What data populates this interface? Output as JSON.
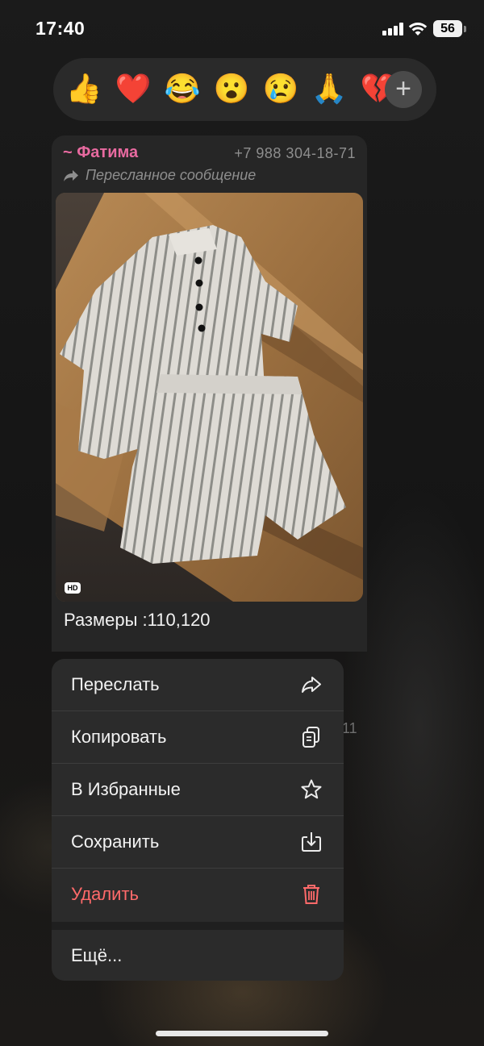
{
  "status_bar": {
    "time": "17:40",
    "battery": "56"
  },
  "reactions": {
    "items": [
      "👍",
      "❤️",
      "😂",
      "😮",
      "😢",
      "🙏",
      "💔"
    ],
    "add_label": "+"
  },
  "message": {
    "sender_name": "~ Фатима",
    "sender_phone": "+7 988 304-18-71",
    "forwarded_label": "Пересланное сообщение",
    "hd_badge": "HD",
    "caption": "Размеры :110,120",
    "hidden_timestamp": "11"
  },
  "context_menu": {
    "items": [
      {
        "label": "Переслать",
        "icon": "forward-icon"
      },
      {
        "label": "Копировать",
        "icon": "copy-icon"
      },
      {
        "label": "В Избранные",
        "icon": "star-icon"
      },
      {
        "label": "Сохранить",
        "icon": "save-icon"
      },
      {
        "label": "Удалить",
        "icon": "trash-icon",
        "color": "#ff6a6a"
      }
    ],
    "more_label": "Ещё..."
  },
  "colors": {
    "sender_name": "#e86aa0",
    "danger": "#ff6a6a",
    "menu_bg": "#2b2b2b"
  }
}
